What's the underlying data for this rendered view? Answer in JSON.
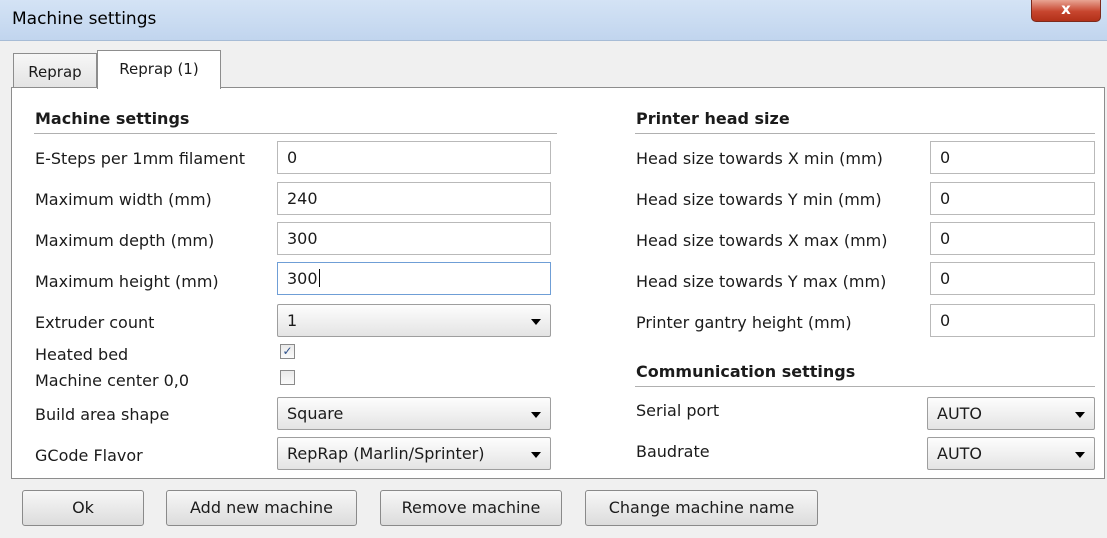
{
  "window": {
    "title": "Machine settings",
    "close_glyph": "x"
  },
  "tabs": [
    {
      "label": "Reprap"
    },
    {
      "label": "Reprap (1)"
    }
  ],
  "machine": {
    "section_title": "Machine settings",
    "e_steps": {
      "label": "E-Steps per 1mm filament",
      "value": "0"
    },
    "max_width": {
      "label": "Maximum width (mm)",
      "value": "240"
    },
    "max_depth": {
      "label": "Maximum depth (mm)",
      "value": "300"
    },
    "max_height": {
      "label": "Maximum height (mm)",
      "value": "300"
    },
    "extruder_count": {
      "label": "Extruder count",
      "value": "1"
    },
    "heated_bed": {
      "label": "Heated bed",
      "checked": true
    },
    "machine_center": {
      "label": "Machine center 0,0",
      "checked": false
    },
    "build_area_shape": {
      "label": "Build area shape",
      "value": "Square"
    },
    "gcode_flavor": {
      "label": "GCode Flavor",
      "value": "RepRap (Marlin/Sprinter)"
    }
  },
  "head": {
    "section_title": "Printer head size",
    "x_min": {
      "label": "Head size towards X min (mm)",
      "value": "0"
    },
    "y_min": {
      "label": "Head size towards Y min (mm)",
      "value": "0"
    },
    "x_max": {
      "label": "Head size towards X max (mm)",
      "value": "0"
    },
    "y_max": {
      "label": "Head size towards Y max (mm)",
      "value": "0"
    },
    "gantry_height": {
      "label": "Printer gantry height (mm)",
      "value": "0"
    }
  },
  "communication": {
    "section_title": "Communication settings",
    "serial_port": {
      "label": "Serial port",
      "value": "AUTO"
    },
    "baudrate": {
      "label": "Baudrate",
      "value": "AUTO"
    }
  },
  "buttons": {
    "ok": "Ok",
    "add": "Add new machine",
    "remove": "Remove machine",
    "rename": "Change machine name"
  },
  "check_glyph": "✓"
}
